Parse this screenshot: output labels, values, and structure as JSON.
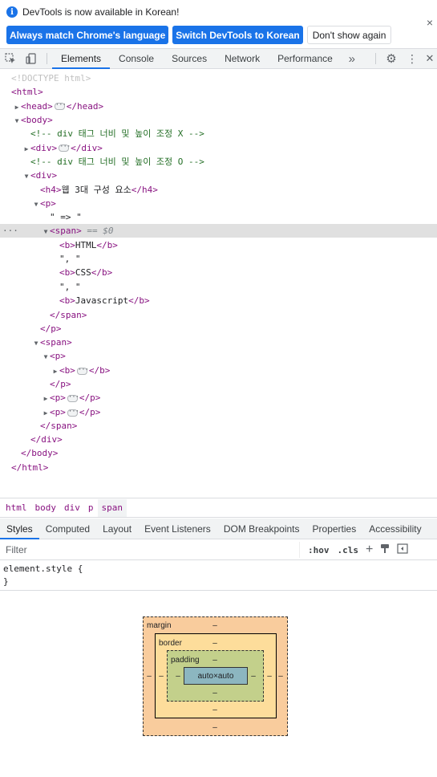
{
  "infobar": {
    "message": "DevTools is now available in Korean!",
    "info_glyph": "i",
    "close_glyph": "×",
    "buttons": {
      "match_language": "Always match Chrome's language",
      "switch_korean": "Switch DevTools to Korean",
      "dont_show": "Don't show again"
    }
  },
  "toolbar": {
    "tabs": [
      "Elements",
      "Console",
      "Sources",
      "Network",
      "Performance"
    ],
    "active_tab": "Elements",
    "more_glyph": "»",
    "settings_glyph": "⚙",
    "menu_glyph": "⋮",
    "close_glyph": "✕"
  },
  "tree": {
    "doctype": "<!DOCTYPE html>",
    "html_open": "<html>",
    "head_open": "<head>",
    "head_close": "</head>",
    "body_open": "<body>",
    "comment_x": "<!-- div 태그 너비 및 높이 조정 X -->",
    "div_open": "<div>",
    "div_close": "</div>",
    "comment_o": "<!-- div 태그 너비 및 높이 조정 O -->",
    "h4_open": "<h4>",
    "h4_text": "웹 3대 구성 요소",
    "h4_close": "</h4>",
    "p_open": "<p>",
    "text_arrow": "\" => \"",
    "span_open": "<span>",
    "selected_marker": "== $0",
    "b_open": "<b>",
    "b_close": "</b>",
    "html_text": "HTML",
    "comma_text": "\", \"",
    "css_text": "CSS",
    "js_text": "Javascript",
    "span_close": "</span>",
    "p_close": "</p>",
    "body_close": "</body>",
    "html_close": "</html>",
    "expanded_glyph": "▼",
    "collapsed_glyph": "▶",
    "gutter_dots": "···"
  },
  "breadcrumbs": [
    "html",
    "body",
    "div",
    "p",
    "span"
  ],
  "breadcrumbs_active": "span",
  "styles_tabs": [
    "Styles",
    "Computed",
    "Layout",
    "Event Listeners",
    "DOM Breakpoints",
    "Properties",
    "Accessibility"
  ],
  "styles_active": "Styles",
  "filter": {
    "placeholder": "Filter",
    "hov": ":hov",
    "cls": ".cls",
    "add_glyph": "+",
    "paint_glyph": "▾",
    "sidebar_glyph": "◧"
  },
  "element_style": {
    "selector": "element.style {",
    "close": "}"
  },
  "box_model": {
    "margin_label": "margin",
    "border_label": "border",
    "padding_label": "padding",
    "content": "auto×auto",
    "dash": "–"
  }
}
